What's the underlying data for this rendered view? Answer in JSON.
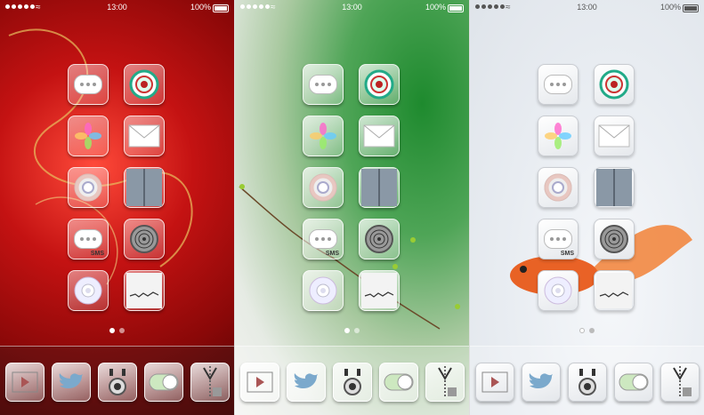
{
  "status": {
    "time": "13:00",
    "battery": "100%"
  },
  "panels": [
    "red-theme",
    "green-theme",
    "white-theme"
  ],
  "icons": [
    "messages-icon",
    "clock-icon",
    "photos-icon",
    "mail-icon",
    "chrome-icon",
    "door-icon",
    "sms-icon",
    "fingerprint-icon",
    "ipod-icon",
    "notes-icon"
  ],
  "sms_label": "SMS",
  "dock": [
    "video-icon",
    "twitter-icon",
    "camera-icon",
    "toggle-icon",
    "zip-icon"
  ],
  "colors": {
    "red": "#c41212",
    "green": "#1e8a2e",
    "white": "#eef1f4"
  }
}
